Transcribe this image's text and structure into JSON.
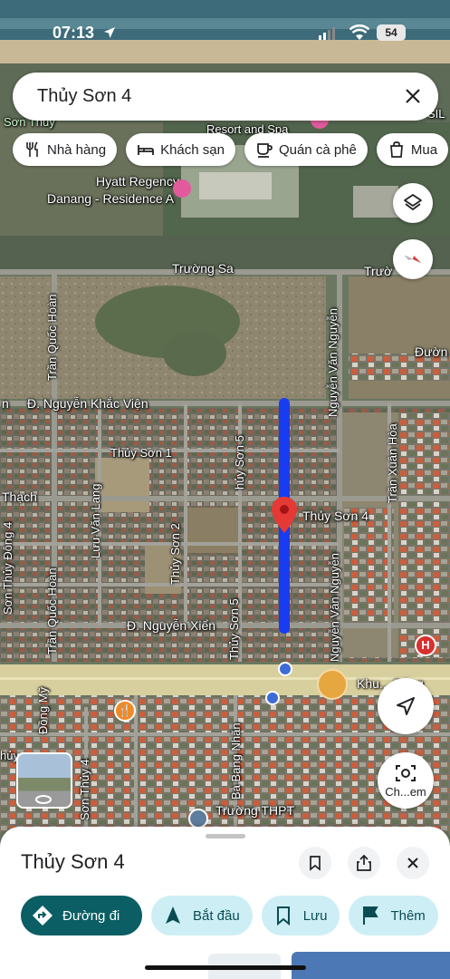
{
  "status_bar": {
    "time": "07:13",
    "battery": "54"
  },
  "search": {
    "query": "Thủy Sơn 4"
  },
  "chips": [
    {
      "label": "Nhà hàng",
      "icon": "fork-knife-icon"
    },
    {
      "label": "Khách sạn",
      "icon": "bed-icon"
    },
    {
      "label": "Quán cà phê",
      "icon": "coffee-icon"
    },
    {
      "label": "Mua",
      "icon": "shopping-bag-icon"
    }
  ],
  "map": {
    "labels": {
      "son_thuy": "Sơn Thủy",
      "resort": "Resort and Spa",
      "sil": "SIL",
      "hyatt1": "Hyatt Regency",
      "hyatt2": "Danang - Residence A",
      "truong_sa": "Trường Sa",
      "truong_sa_right": "Trườ",
      "tran_quoc_hoan": "Trần Quốc Hoàn",
      "tran_quoc_hoan_2": "Trần Quốc Hoàn",
      "nguyen_van_nguyen": "Nguyễn Văn Nguyễn",
      "nguyen_van_nguyen_2": "Nguyễn Văn Nguyễn",
      "duong_right": "Đườn",
      "n_prefix": "n",
      "nguyen_khac_vien": "Đ. Nguyễn Khắc Viện",
      "thuy_son_1": "Thủy Sơn 1",
      "thuy_son_5a": "hủy Sơn 5",
      "thuy_son_5b": "Thủy Sơn 5",
      "tran_xuan_hoa": "Trần Xuân Hòa",
      "thach": "Thạch",
      "luu_van_lang": "Lưu Văn Lang",
      "thuy_son_4_pin": "Thủy Sơn 4",
      "son_thuy_dong_4": "Sơn Thủy Đông 4",
      "thuy_son_2": "Thủy Sơn 2",
      "nguyen_xien": "Đ. Nguyễn Xiển",
      "khue_dong": "Khu... Đông",
      "dong_my": "Đồng Mỹ",
      "son_thuy_4": "Sơn Thủy 4",
      "ba_bang_nhan": "Bà Bang Nhãn",
      "truong_thpt": "Trường THPT",
      "thuy_left": "hủy"
    }
  },
  "fab": {
    "streetview_label": "Ch...em"
  },
  "sheet": {
    "title": "Thủy Sơn 4",
    "actions": [
      {
        "label": "Đường đi",
        "icon": "directions-icon"
      },
      {
        "label": "Bắt đầu",
        "icon": "navigation-arrow-icon"
      },
      {
        "label": "Lưu",
        "icon": "bookmark-icon"
      },
      {
        "label": "Thêm",
        "icon": "flag-icon"
      }
    ]
  },
  "colors": {
    "route": "#1a3cf0",
    "pin": "#e53935",
    "primary_action": "#0b5e63",
    "secondary_action": "#cdeef5"
  }
}
